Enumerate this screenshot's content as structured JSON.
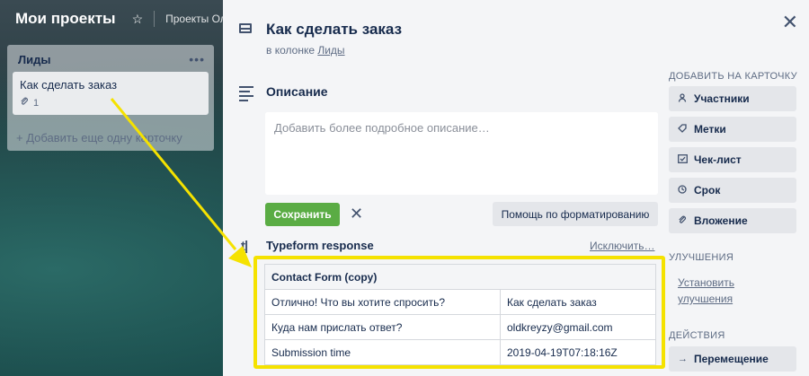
{
  "board": {
    "title": "Мои проекты",
    "team_label": "Проекты Оля",
    "list": {
      "title": "Лиды",
      "menu_glyph": "•••",
      "card": {
        "title": "Как сделать заказ",
        "attachment_count": "1"
      },
      "add_card_label": "+ Добавить еще одну карточку"
    }
  },
  "modal": {
    "title": "Как сделать заказ",
    "in_list_prefix": "в колонке",
    "in_list_name": "Лиды",
    "close_glyph": "✕",
    "description": {
      "title": "Описание",
      "placeholder": "Добавить более подробное описание…",
      "save_label": "Сохранить",
      "cancel_glyph": "✕",
      "help_label": "Помощь по форматированию"
    },
    "typeform": {
      "icon_text": "t|",
      "title": "Typeform response",
      "exclude_label": "Исключить…",
      "form_name": "Contact Form (copy)",
      "rows": [
        {
          "question": "Отлично! Что вы хотите спросить?",
          "answer": "Как сделать заказ"
        },
        {
          "question": "Куда нам прислать ответ?",
          "answer": "oldkreyzy@gmail.com"
        },
        {
          "question": "Submission time",
          "answer": "2019-04-19T07:18:16Z"
        }
      ]
    },
    "sidebar": {
      "add_heading": "ДОБАВИТЬ НА КАРТОЧКУ",
      "add_buttons": [
        {
          "label": "Участники",
          "icon": "person-icon"
        },
        {
          "label": "Метки",
          "icon": "tag-icon"
        },
        {
          "label": "Чек-лист",
          "icon": "checklist-icon"
        },
        {
          "label": "Срок",
          "icon": "clock-icon"
        },
        {
          "label": "Вложение",
          "icon": "paperclip-icon"
        }
      ],
      "improvements_heading": "УЛУЧШЕНИЯ",
      "install_link": "Установить улучшения",
      "actions_heading": "ДЕЙСТВИЯ",
      "move_label": "Перемещение"
    }
  },
  "colors": {
    "save_green": "#5aac44",
    "highlight_yellow": "#f5e200"
  }
}
